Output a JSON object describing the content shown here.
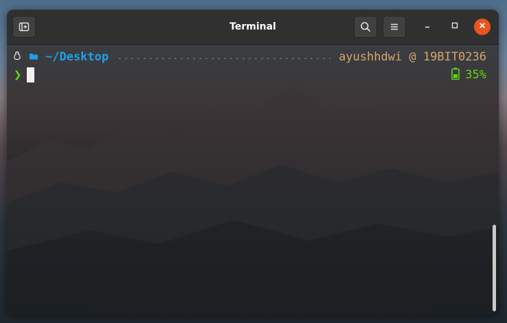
{
  "window": {
    "title": "Terminal"
  },
  "titlebar": {
    "new_tab_icon": "new-tab-icon",
    "search_icon": "search-icon",
    "menu_icon": "hamburger-menu-icon",
    "minimize_icon": "minimize-icon",
    "maximize_icon": "maximize-icon",
    "close_icon": "close-icon"
  },
  "prompt": {
    "os_icon": "linux-tux-icon",
    "folder_icon": "folder-icon",
    "path": "~/Desktop",
    "user_host": "ayushhdwi @ 19BIT0236",
    "symbol": "❯",
    "battery_icon": "battery-icon",
    "battery_percent": "35%"
  },
  "colors": {
    "path": "#1ea0e6",
    "user_host": "#d6a56e",
    "prompt_symbol": "#5fd31a",
    "battery": "#5fd31a",
    "close_button": "#e95420"
  }
}
